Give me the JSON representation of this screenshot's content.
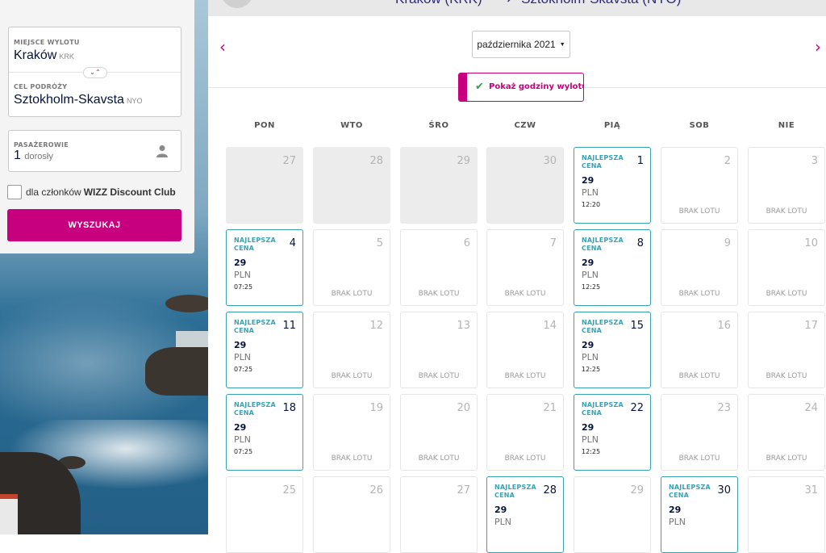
{
  "search": {
    "origin_label": "MIEJSCE WYLOTU",
    "origin_city": "Kraków",
    "origin_code": "KRK",
    "destination_label": "CEL PODRÓŻY",
    "destination_city": "Sztokholm-Skavsta",
    "destination_code": "NYO",
    "passengers_label": "PASAŻEROWIE",
    "passengers_count": "1",
    "passengers_unit": "dorosły",
    "club_label": "dla członków",
    "club_name": "WIZZ Discount Club",
    "search_button": "WYSZUKAJ"
  },
  "route": {
    "origin": "Kraków (KRK)",
    "destination": "Sztokholm-Skavsta (NYO)"
  },
  "calendar": {
    "month": "października 2021",
    "toggle_label": "Pokaż godziny wylotu",
    "weekdays": [
      "PON",
      "WTO",
      "ŚRO",
      "CZW",
      "PIĄ",
      "SOB",
      "NIE"
    ],
    "days": [
      {
        "day": "27",
        "status": "past"
      },
      {
        "day": "28",
        "status": "past"
      },
      {
        "day": "29",
        "status": "past"
      },
      {
        "day": "30",
        "status": "past"
      },
      {
        "day": "1",
        "status": "best",
        "badge": "NAJLEPSZA CENA",
        "price": "29",
        "currency": "PLN",
        "time": "12:20"
      },
      {
        "day": "2",
        "status": "none",
        "note": "BRAK LOTU"
      },
      {
        "day": "3",
        "status": "none",
        "note": "BRAK LOTU"
      },
      {
        "day": "4",
        "status": "best",
        "badge": "NAJLEPSZA CENA",
        "price": "29",
        "currency": "PLN",
        "time": "07:25"
      },
      {
        "day": "5",
        "status": "none",
        "note": "BRAK LOTU"
      },
      {
        "day": "6",
        "status": "none",
        "note": "BRAK LOTU"
      },
      {
        "day": "7",
        "status": "none",
        "note": "BRAK LOTU"
      },
      {
        "day": "8",
        "status": "best",
        "badge": "NAJLEPSZA CENA",
        "price": "29",
        "currency": "PLN",
        "time": "12:25"
      },
      {
        "day": "9",
        "status": "none",
        "note": "BRAK LOTU"
      },
      {
        "day": "10",
        "status": "none",
        "note": "BRAK LOTU"
      },
      {
        "day": "11",
        "status": "best",
        "badge": "NAJLEPSZA CENA",
        "price": "29",
        "currency": "PLN",
        "time": "07:25"
      },
      {
        "day": "12",
        "status": "none",
        "note": "BRAK LOTU"
      },
      {
        "day": "13",
        "status": "none",
        "note": "BRAK LOTU"
      },
      {
        "day": "14",
        "status": "none",
        "note": "BRAK LOTU"
      },
      {
        "day": "15",
        "status": "best",
        "badge": "NAJLEPSZA CENA",
        "price": "29",
        "currency": "PLN",
        "time": "12:25"
      },
      {
        "day": "16",
        "status": "none",
        "note": "BRAK LOTU"
      },
      {
        "day": "17",
        "status": "none",
        "note": "BRAK LOTU"
      },
      {
        "day": "18",
        "status": "best",
        "badge": "NAJLEPSZA CENA",
        "price": "29",
        "currency": "PLN",
        "time": "07:25"
      },
      {
        "day": "19",
        "status": "none",
        "note": "BRAK LOTU"
      },
      {
        "day": "20",
        "status": "none",
        "note": "BRAK LOTU"
      },
      {
        "day": "21",
        "status": "none",
        "note": "BRAK LOTU"
      },
      {
        "day": "22",
        "status": "best",
        "badge": "NAJLEPSZA CENA",
        "price": "29",
        "currency": "PLN",
        "time": "12:25"
      },
      {
        "day": "23",
        "status": "none",
        "note": "BRAK LOTU"
      },
      {
        "day": "24",
        "status": "none",
        "note": "BRAK LOTU"
      },
      {
        "day": "25",
        "status": "empty"
      },
      {
        "day": "26",
        "status": "empty"
      },
      {
        "day": "27",
        "status": "empty"
      },
      {
        "day": "28",
        "status": "best",
        "badge": "NAJLEPSZA CENA",
        "price": "29",
        "currency": "PLN"
      },
      {
        "day": "29",
        "status": "empty"
      },
      {
        "day": "30",
        "status": "best",
        "badge": "NAJLEPSZA CENA",
        "price": "29",
        "currency": "PLN"
      },
      {
        "day": "31",
        "status": "empty"
      }
    ]
  },
  "colors": {
    "brand": "#c6007e",
    "best_price": "#3aa1b4",
    "navy": "#06143c"
  }
}
